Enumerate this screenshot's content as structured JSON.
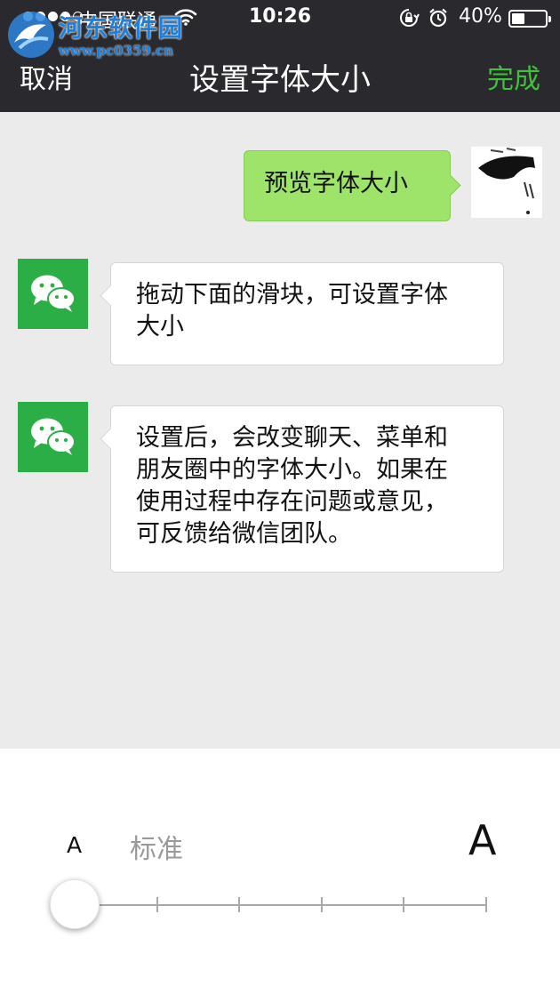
{
  "status_bar": {
    "carrier": "中国联通",
    "time": "10:26",
    "battery_percent_text": "40%",
    "battery_level": 0.4,
    "signal_bars_filled": 4,
    "signal_bars_total": 5
  },
  "watermark": {
    "title": "河东软件园",
    "url": "www.pc0359.cn"
  },
  "nav": {
    "cancel_label": "取消",
    "title": "设置字体大小",
    "done_label": "完成"
  },
  "chat": {
    "messages": [
      {
        "side": "right",
        "sender": "user",
        "text": "预览字体大小"
      },
      {
        "side": "left",
        "sender": "wechat",
        "lines": [
          "拖动下面的滑块，可设置字体",
          "大小"
        ]
      },
      {
        "side": "left",
        "sender": "wechat",
        "lines": [
          "设置后，会改变聊天、菜单和",
          "朋友圈中的字体大小。如果在",
          "使用过程中存在问题或意见，",
          "可反馈给微信团队。"
        ]
      }
    ]
  },
  "font_size_control": {
    "small_label": "A",
    "current_label": "标准",
    "large_label": "A",
    "steps": 6,
    "selected_step": 1
  },
  "colors": {
    "header_bg": "#2a2a2e",
    "done_green": "#3fc13b",
    "wechat_green": "#2aae45",
    "user_bubble": "#9ee46b",
    "chat_bg": "#ebebeb"
  },
  "icons": {
    "wifi": "wifi-icon",
    "lock": "orientation-lock-icon",
    "alarm": "alarm-icon",
    "battery": "battery-icon",
    "avatar": "wechat-logo-icon"
  }
}
